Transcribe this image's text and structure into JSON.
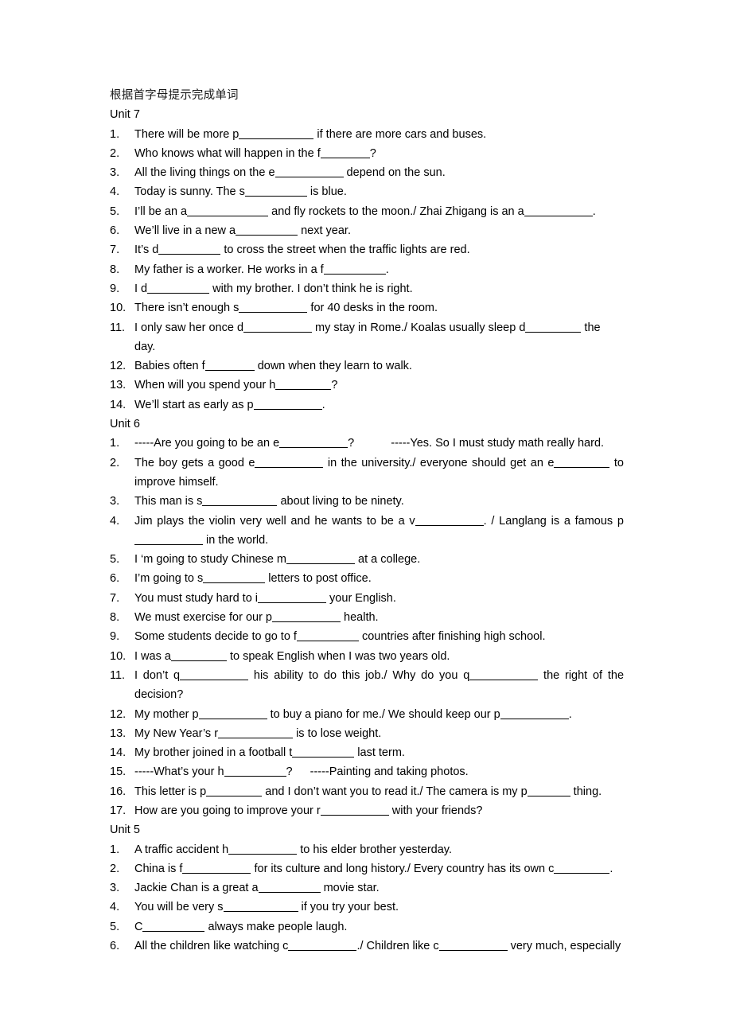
{
  "document": {
    "title": "根据首字母提示完成单词"
  },
  "units": [
    {
      "heading": "Unit 7",
      "items": [
        {
          "num": "1.",
          "pre": "There will be more p",
          "blank": 11,
          "post": " if there are more cars and buses."
        },
        {
          "num": "2.",
          "pre": "Who knows what will happen in the f",
          "blank": 7,
          "post": "?"
        },
        {
          "num": "3.",
          "pre": "All the living things on the e",
          "blank": 10,
          "post": " depend on the sun."
        },
        {
          "num": "4.",
          "pre": "Today is sunny. The s",
          "blank": 9,
          "post": " is blue."
        },
        {
          "num": "5.",
          "pre": "I’ll be an a",
          "blank": 12,
          "post": " and fly rockets to the moon./ Zhai Zhigang is an a",
          "blank2": 10,
          "post2": "."
        },
        {
          "num": "6.",
          "pre": "We’ll live in a new a",
          "blank": 9,
          "post": " next year."
        },
        {
          "num": "7.",
          "pre": "It’s d",
          "blank": 9,
          "post": " to cross the street when the traffic lights are red."
        },
        {
          "num": "8.",
          "pre": "My father is a worker. He works in a f",
          "blank": 9,
          "post": "."
        },
        {
          "num": "9.",
          "pre": "I d",
          "blank": 9,
          "post": " with my brother. I don’t think he is right."
        },
        {
          "num": "10.",
          "pre": "There isn’t enough s",
          "blank": 10,
          "post": " for 40 desks in the room."
        },
        {
          "num": "11.",
          "pre": "I only saw her once d",
          "blank": 10,
          "post": " my stay in Rome./ Koalas usually sleep d",
          "blank2": 8,
          "post2": " the day."
        },
        {
          "num": "12.",
          "pre": "Babies often f",
          "blank": 7,
          "post": " down when they learn to walk."
        },
        {
          "num": "13.",
          "pre": "When will you spend your h",
          "blank": 8,
          "post": "?"
        },
        {
          "num": "14.",
          "pre": "We’ll start as early as p",
          "blank": 10,
          "post": "."
        }
      ]
    },
    {
      "heading": "Unit 6",
      "items": [
        {
          "num": "1.",
          "pre": "-----Are you going to be an e",
          "blank": 10,
          "post": "?",
          "gap": true,
          "post_gap": "-----Yes. So I must study math really hard."
        },
        {
          "num": "2.",
          "pre": "The boy gets a good e",
          "blank": 10,
          "post": " in the university./ everyone should get an e",
          "blank2": 8,
          "post2": " to improve himself.",
          "justify": true
        },
        {
          "num": "3.",
          "pre": "This man is s",
          "blank": 11,
          "post": " about living to be ninety."
        },
        {
          "num": "4.",
          "pre": "Jim plays the violin very well and he wants to be a v",
          "blank": 10,
          "post": ". / Langlang is a famous p",
          "blank2": 10,
          "post2": " in the world.",
          "justify": true
        },
        {
          "num": "5.",
          "pre": "I ‘m going to study Chinese m",
          "blank": 10,
          "post": " at a college."
        },
        {
          "num": "6.",
          "pre": "I’m going to s",
          "blank": 9,
          "post": " letters to post office."
        },
        {
          "num": "7.",
          "pre": "You must study hard to i",
          "blank": 10,
          "post": " your English."
        },
        {
          "num": "8.",
          "pre": "We must exercise for our p",
          "blank": 10,
          "post": " health."
        },
        {
          "num": "9.",
          "pre": "Some students decide to go to f",
          "blank": 9,
          "post": " countries after finishing high school."
        },
        {
          "num": "10.",
          "pre": "I was a",
          "blank": 8,
          "post": " to speak English when I was two years old."
        },
        {
          "num": "11.",
          "pre": "I don’t q",
          "blank": 10,
          "post": " his ability to do this job./ Why do you q",
          "blank2": 10,
          "post2": " the right of the decision?",
          "justify": true
        },
        {
          "num": "12.",
          "pre": "My mother p",
          "blank": 10,
          "post": " to buy a piano for me./ We should keep our p",
          "blank2": 10,
          "post2": "."
        },
        {
          "num": "13.",
          "pre": "My New Year’s r",
          "blank": 11,
          "post": " is to lose weight."
        },
        {
          "num": "14.",
          "pre": "My brother joined in a football t",
          "blank": 9,
          "post": " last term."
        },
        {
          "num": "15.",
          "pre": "-----What’s your h",
          "blank": 9,
          "post": "?",
          "gap_md": true,
          "post_gap": "-----Painting and taking photos."
        },
        {
          "num": "16.",
          "pre": "This letter is p",
          "blank": 8,
          "post": " and I don’t want you to read it./ The camera is my p",
          "blank2": 6,
          "post2": " thing."
        },
        {
          "num": "17.",
          "pre": "How are you going to improve your r",
          "blank": 10,
          "post": " with your friends?"
        }
      ]
    },
    {
      "heading": "Unit 5",
      "items": [
        {
          "num": "1.",
          "pre": "A traffic accident h",
          "blank": 10,
          "post": " to his elder brother yesterday."
        },
        {
          "num": "2.",
          "pre": "China is f",
          "blank": 10,
          "post": " for its culture and long history./ Every country has its own c",
          "blank2": 8,
          "post2": "."
        },
        {
          "num": "3.",
          "pre": "Jackie Chan is a great a",
          "blank": 9,
          "post": " movie star."
        },
        {
          "num": "4.",
          "pre": "You will be very s",
          "blank": 11,
          "post": " if you try your best."
        },
        {
          "num": "5.",
          "pre": "C",
          "blank": 9,
          "post": " always make people laugh."
        },
        {
          "num": "6.",
          "pre": "All the children like watching c",
          "blank": 10,
          "post": "./ Children like c",
          "blank2": 10,
          "post2": " very much, especially"
        }
      ]
    }
  ]
}
